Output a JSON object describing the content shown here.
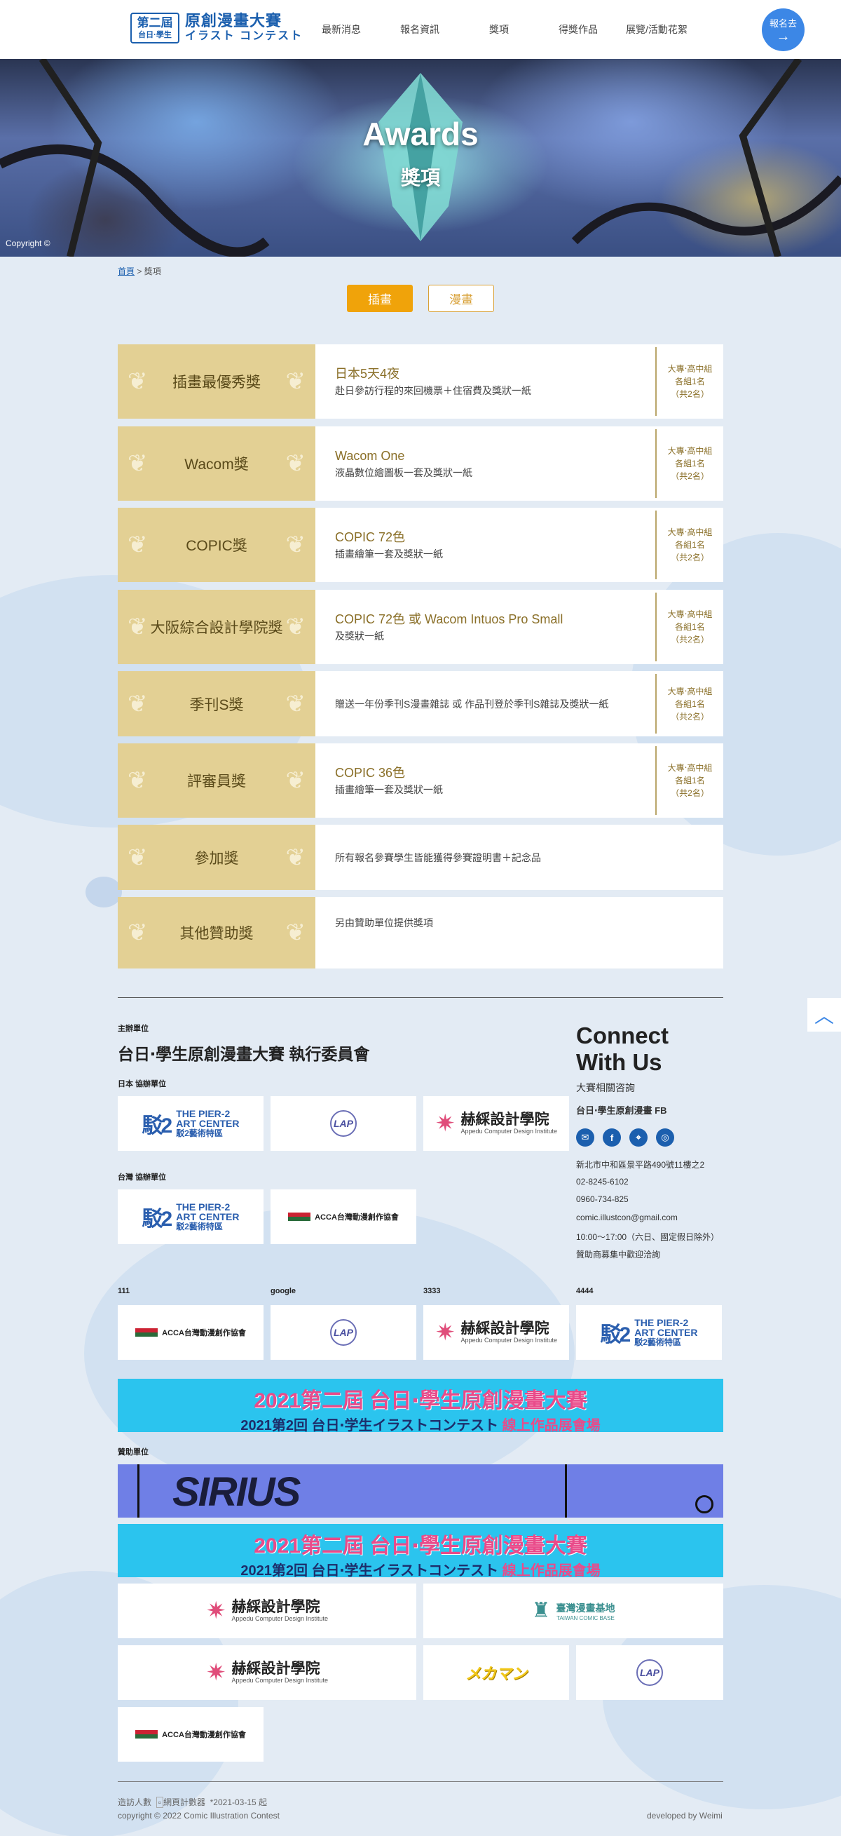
{
  "header": {
    "logo": {
      "badge_top": "第二屆",
      "badge_bottom": "台日·學生",
      "title": "原創漫畫大賽",
      "subtitle": "イラスト コンテスト"
    },
    "nav": [
      "最新消息",
      "報名資訊",
      "獎項",
      "得獎作品",
      "展覽/活動花絮"
    ],
    "signup": {
      "label": "報名去",
      "arrow": "→"
    }
  },
  "banner": {
    "title": "Awards",
    "subtitle": "獎項",
    "credit": "Copyright ©"
  },
  "breadcrumb": {
    "home": "首頁",
    "sep": ">",
    "current": "獎項"
  },
  "tabs": [
    {
      "label": "插畫",
      "active": true
    },
    {
      "label": "漫畫",
      "active": false
    }
  ],
  "awards": [
    {
      "name": "插畫最優秀獎",
      "prize": "日本5天4夜",
      "desc": "赴日參訪行程的來回機票＋住宿費及獎狀一紙",
      "qty": [
        "大專‧高中組",
        "各組1名",
        "（共2名）"
      ]
    },
    {
      "name": "Wacom獎",
      "prize": "Wacom One",
      "desc": "液晶數位繪圖板一套及獎狀一紙",
      "qty": [
        "大專‧高中組",
        "各組1名",
        "（共2名）"
      ]
    },
    {
      "name": "COPIC獎",
      "prize": "COPIC 72色",
      "desc": "插畫繪筆一套及獎狀一紙",
      "qty": [
        "大專‧高中組",
        "各組1名",
        "（共2名）"
      ]
    },
    {
      "name": "大阪綜合設計學院獎",
      "prize": "COPIC 72色 或 Wacom Intuos Pro Small",
      "desc": "及獎狀一紙",
      "qty": [
        "大專‧高中組",
        "各組1名",
        "（共2名）"
      ]
    },
    {
      "name": "季刊S獎",
      "prize": "",
      "desc": "贈送一年份季刊S漫畫雜誌 或 作品刊登於季刊S雜誌及獎狀一紙",
      "qty": [
        "大專‧高中組",
        "各組1名",
        "（共2名）"
      ]
    },
    {
      "name": "評審員獎",
      "prize": "COPIC 36色",
      "desc": "插畫繪筆一套及獎狀一紙",
      "qty": [
        "大專‧高中組",
        "各組1名",
        "（共2名）"
      ]
    },
    {
      "name": "參加獎",
      "prize": "",
      "desc": "所有報名參賽學生皆能獲得參賽證明書＋記念品",
      "qty": []
    },
    {
      "name": "其他贊助獎",
      "prize": "",
      "desc": "另由贊助單位提供獎項",
      "qty": []
    }
  ],
  "organizers": {
    "host_label": "主辦單位",
    "host_name": "台日‧學生原創漫畫大賽 執行委員會",
    "japan_label": "日本 協辦單位",
    "taiwan_label": "台灣 協辦單位",
    "extra_labels": [
      "111",
      "google",
      "3333",
      "4444"
    ],
    "sponsor_label": "贊助單位"
  },
  "logos": {
    "pier_title": "THE PIER-2",
    "pier_line2": "ART CENTER",
    "pier_zh": "駁2藝術特區",
    "lap": "LAP",
    "apd_name": "赫綵設計學院",
    "apd_en": "Appedu Computer Design Institute",
    "acca": "ACCA台灣動漫創作協會",
    "tcb_name": "臺灣漫畫基地",
    "tcb_en": "TAIWAN COMIC BASE",
    "mekaman": "メカマン",
    "sirius": "SIRIUS"
  },
  "expo": {
    "line1": "2021第二屆 台日‧學生原創漫畫大賽",
    "line2a": "2021第2回 台日‧学生イラストコンテスト ",
    "line2b": "線上作品展會場"
  },
  "connect": {
    "title_line1": "Connect",
    "title_line2": "With Us",
    "subtitle": "大賽相關咨詢",
    "fb": "台日‧學生原創漫畫 FB",
    "address": "新北市中和區景平路490號11樓之2",
    "phone1": "02-8245-6102",
    "phone2": "0960-734-825",
    "email": "comic.illustcon@gmail.com",
    "hours": "10:00～17:00（六日、國定假日除外）",
    "note": "贊助商募集中歡迎洽詢"
  },
  "footer": {
    "visitors": "造訪人數",
    "counter_alt": "網頁計數器",
    "since": "*2021-03-15 起",
    "copyright": "copyright © 2022 Comic Illustration Contest",
    "developer": "developed by Weimi"
  },
  "colors": {
    "gold": "#e3d094",
    "accent_orange": "#f0a30a",
    "brand_blue": "#1b5fae",
    "button_blue": "#3c87e6"
  }
}
